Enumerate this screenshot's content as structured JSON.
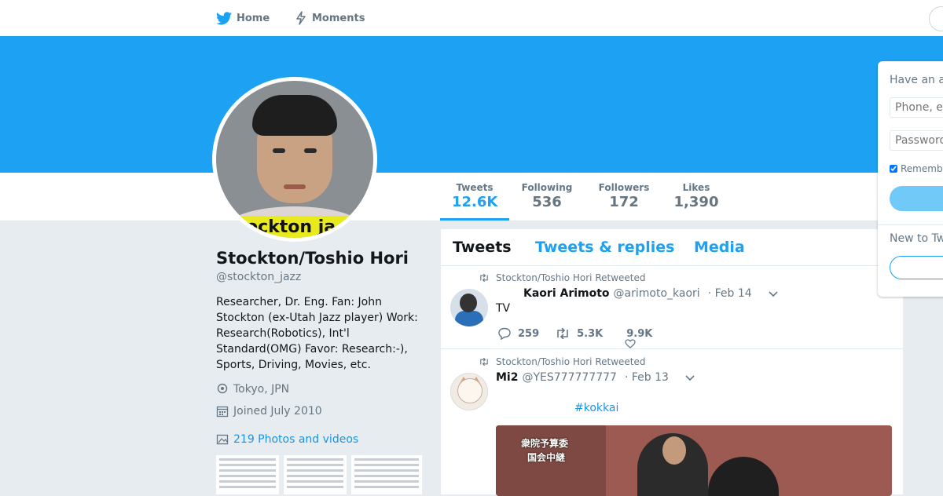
{
  "nav": {
    "home_label": "Home",
    "moments_label": "Moments"
  },
  "colors": {
    "brand": "#1da1f2",
    "link": "#1b95e0",
    "muted": "#657786"
  },
  "profile": {
    "name": "Stockton/Toshio Hori",
    "handle": "@stockton_jazz",
    "bio": "Researcher, Dr. Eng. Fan: John Stockton (ex-Utah Jazz player) Work: Research(Robotics), Int'l Standard(OMG) Favor: Research:-), Sports, Driving, Movies, etc.",
    "location": "Tokyo, JPN",
    "joined": "Joined July 2010",
    "photos_link": "219 Photos and videos",
    "avatar_caption": "ockton ja"
  },
  "stats": [
    {
      "label": "Tweets",
      "value": "12.6K"
    },
    {
      "label": "Following",
      "value": "536"
    },
    {
      "label": "Followers",
      "value": "172"
    },
    {
      "label": "Likes",
      "value": "1,390"
    }
  ],
  "timeline_tabs": [
    "Tweets",
    "Tweets & replies",
    "Media"
  ],
  "tweets": [
    {
      "retweet_text": "Stockton/Toshio Hori Retweeted",
      "name": "Kaori Arimoto",
      "handle": "@arimoto_kaori",
      "date": "· Feb 14",
      "text": "TV",
      "replies": "259",
      "retweets": "5.3K",
      "likes": "9.9K"
    },
    {
      "retweet_text": "Stockton/Toshio Hori Retweeted",
      "name": "Mi2",
      "handle": "@YES777777777",
      "date": "· Feb 13",
      "hashtag": "#kokkai",
      "media_caption_1": "衆院予算委",
      "media_caption_2": "国会中継"
    }
  ],
  "login": {
    "title": "Have an account?",
    "phone_placeholder": "Phone, email or username",
    "password_placeholder": "Password",
    "remember_label": "Remember me",
    "new_label": "New to Twitter?"
  }
}
